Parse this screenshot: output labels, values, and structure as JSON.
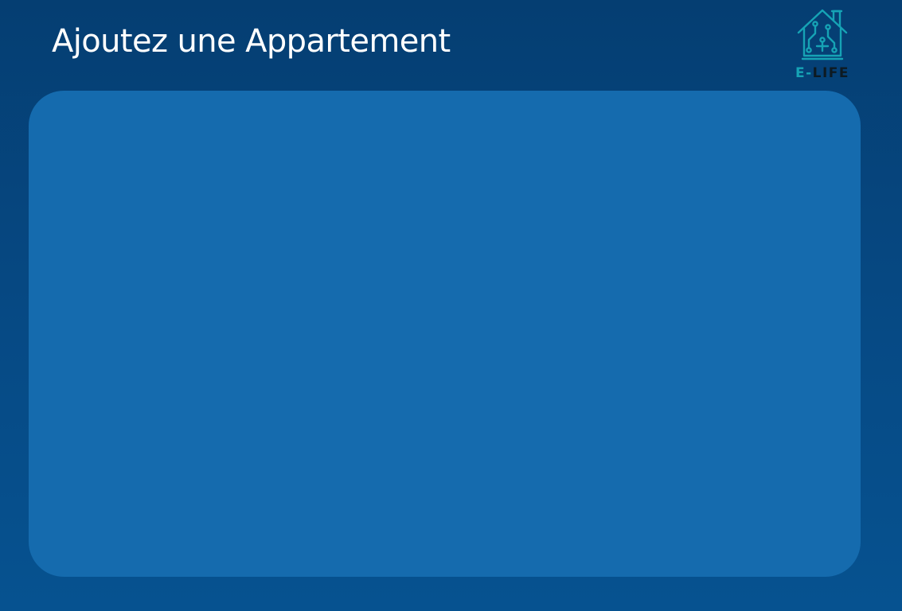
{
  "header": {
    "title": "Ajoutez une Appartement"
  },
  "logo": {
    "icon": "smart-house-circuit-icon",
    "text_prefix": "E-",
    "text_suffix": "LIFE",
    "color_primary": "#16a3b5",
    "color_dark": "#0d1a22"
  },
  "colors": {
    "background_top": "#053e72",
    "background_bottom": "#065290",
    "panel": "#156bae",
    "title_text": "#ffffff"
  }
}
